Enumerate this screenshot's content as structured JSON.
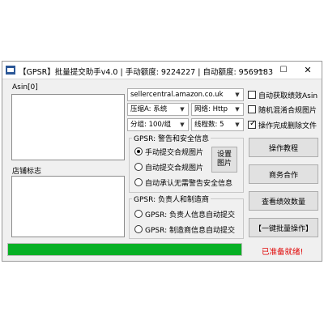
{
  "window": {
    "title": "【GPSR】批量提交助手v4.0 | 手动额度: 9224227 | 自动额度: 9569183",
    "min_glyph": "—",
    "max_glyph": "☐",
    "close_glyph": "✕"
  },
  "asin_box": {
    "label": "Asin[0]",
    "value": ""
  },
  "shop_box": {
    "label": "店铺标志",
    "value": ""
  },
  "settings": {
    "site": "sellercentral.amazon.co.uk",
    "compress": "压缩A: 系统",
    "network": "网络: Http",
    "group": "分组: 100/组",
    "threads": "线程数: 5",
    "arrow_glyph": "▼"
  },
  "options": [
    {
      "label": "自动获取绩效Asin",
      "checked": false
    },
    {
      "label": "随机混淆合规图片",
      "checked": false
    },
    {
      "label": "操作完成删除文件",
      "checked": true
    }
  ],
  "warning_group": {
    "label": "GPSR: 警告和安全信息",
    "radios": [
      {
        "label": "手动提交合规图片",
        "selected": true
      },
      {
        "label": "自动提交合规图片",
        "selected": false
      },
      {
        "label": "自动承认无需警告安全信息",
        "selected": false
      }
    ],
    "set_image_button": "设置图片"
  },
  "responsible_group": {
    "label": "GPSR: 负责人和制造商",
    "radios": [
      {
        "label": "GPSR: 负责人信息自动提交",
        "selected": false
      },
      {
        "label": "GPSR: 制造商信息自动提交",
        "selected": false
      }
    ]
  },
  "buttons": {
    "tutorial": "操作教程",
    "business": "商务合作",
    "view_count": "查看绩效数量",
    "batch": "【一键批量操作】"
  },
  "progress": {
    "percent": 100
  },
  "status": {
    "text": "已准备就绪!",
    "color": "#e00000"
  }
}
